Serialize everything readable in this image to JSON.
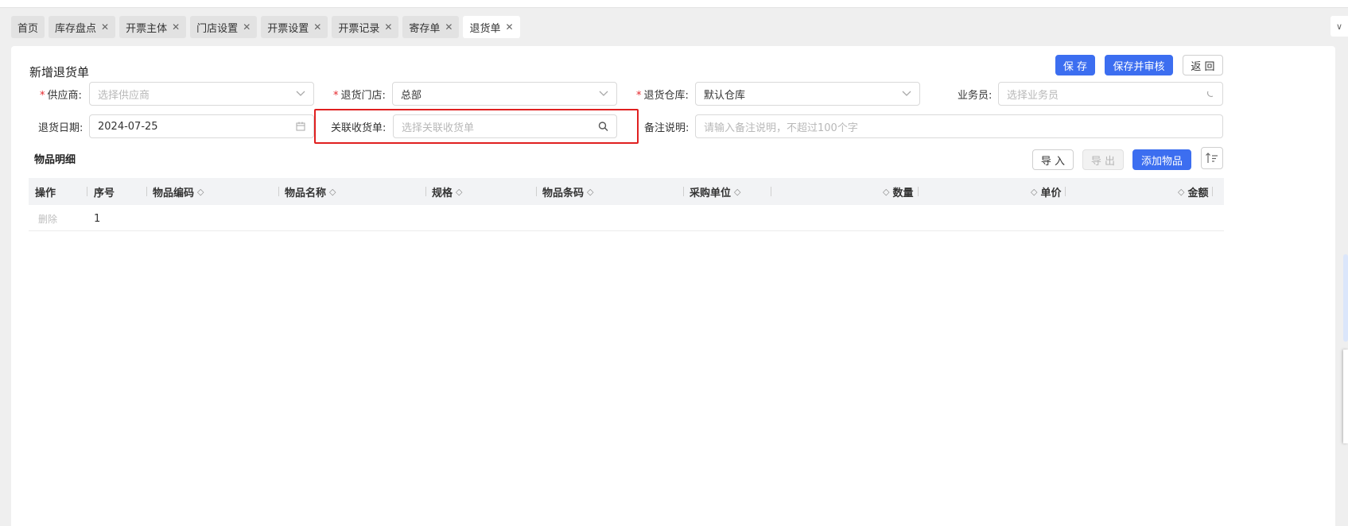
{
  "tabs": [
    {
      "label": "首页",
      "closable": false,
      "active": false
    },
    {
      "label": "库存盘点",
      "closable": true,
      "active": false
    },
    {
      "label": "开票主体",
      "closable": true,
      "active": false
    },
    {
      "label": "门店设置",
      "closable": true,
      "active": false
    },
    {
      "label": "开票设置",
      "closable": true,
      "active": false
    },
    {
      "label": "开票记录",
      "closable": true,
      "active": false
    },
    {
      "label": "寄存单",
      "closable": true,
      "active": false
    },
    {
      "label": "退货单",
      "closable": true,
      "active": true
    }
  ],
  "page": {
    "title": "新增退货单",
    "save_label": "保 存",
    "save_audit_label": "保存并审核",
    "back_label": "返 回"
  },
  "form": {
    "supplier": {
      "label": "供应商:",
      "required": true,
      "placeholder": "选择供应商"
    },
    "store": {
      "label": "退货门店:",
      "required": true,
      "value": "总部"
    },
    "warehouse": {
      "label": "退货仓库:",
      "required": true,
      "value": "默认仓库"
    },
    "salesman": {
      "label": "业务员:",
      "required": false,
      "placeholder": "选择业务员"
    },
    "return_date": {
      "label": "退货日期:",
      "value": "2024-07-25"
    },
    "receipt": {
      "label": "关联收货单:",
      "placeholder": "选择关联收货单"
    },
    "remark": {
      "label": "备注说明:",
      "placeholder": "请输入备注说明，不超过100个字"
    }
  },
  "details": {
    "section_title": "物品明细",
    "import_label": "导 入",
    "export_label": "导 出",
    "add_label": "添加物品",
    "columns": [
      "操作",
      "序号",
      "物品编码",
      "物品名称",
      "规格",
      "物品条码",
      "采购单位",
      "数量",
      "单价",
      "金额"
    ],
    "rows": [
      {
        "action": "删除",
        "index": "1"
      }
    ]
  },
  "colors": {
    "primary": "#3c6ef0",
    "highlight": "#e02020",
    "required": "#e5262b"
  },
  "icons": {
    "select": "chevron-down-icon",
    "date": "calendar-icon",
    "search": "search-icon",
    "sort": "sort-icon",
    "close": "close-icon",
    "loading": "loading-icon"
  }
}
